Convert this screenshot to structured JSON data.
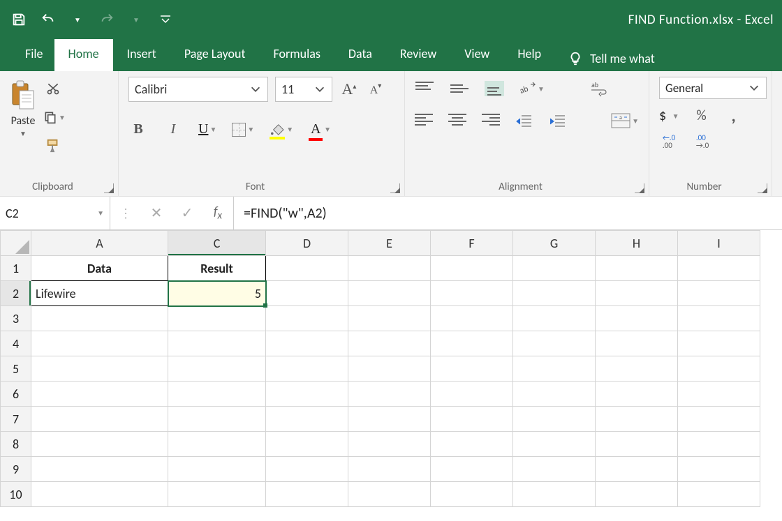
{
  "title": "FIND Function.xlsx  -  Excel",
  "tabs": {
    "file": "File",
    "home": "Home",
    "insert": "Insert",
    "page_layout": "Page Layout",
    "formulas": "Formulas",
    "data": "Data",
    "review": "Review",
    "view": "View",
    "help": "Help",
    "tell_me": "Tell me what"
  },
  "ribbon": {
    "clipboard": {
      "label": "Clipboard",
      "paste": "Paste"
    },
    "font": {
      "label": "Font",
      "name": "Calibri",
      "size": "11"
    },
    "alignment": {
      "label": "Alignment"
    },
    "number": {
      "label": "Number",
      "format": "General",
      "currency": "$",
      "percent": "%",
      "comma": ","
    }
  },
  "name_box": "C2",
  "formula": "=FIND(\"w\",A2)",
  "columns": [
    "A",
    "C",
    "D",
    "E",
    "F",
    "G",
    "H",
    "I"
  ],
  "rows": [
    "1",
    "2",
    "3",
    "4",
    "5",
    "6",
    "7",
    "8",
    "9",
    "10"
  ],
  "cells": {
    "A1": "Data",
    "C1": "Result",
    "A2": "Lifewire",
    "C2": "5"
  }
}
